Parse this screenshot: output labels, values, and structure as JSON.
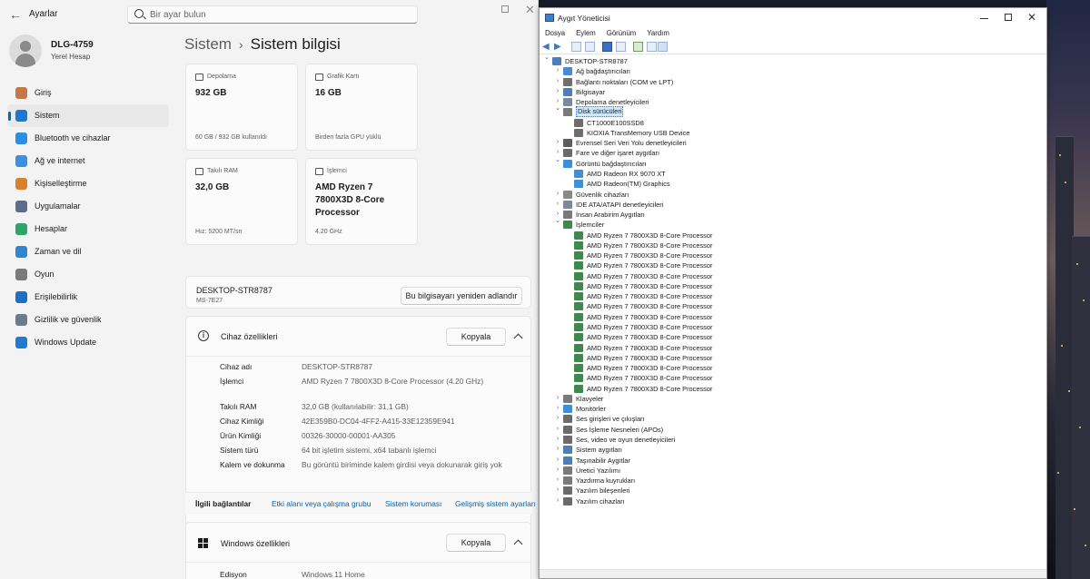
{
  "settings": {
    "app_title": "Ayarlar",
    "search_placeholder": "Bir ayar bulun",
    "user": {
      "name": "DLG-4759",
      "account": "Yerel Hesap"
    },
    "nav": [
      {
        "label": "Giriş",
        "color": "#c4784a",
        "icon": "home-icon"
      },
      {
        "label": "Sistem",
        "color": "#1c78d4",
        "icon": "system-icon",
        "active": true
      },
      {
        "label": "Bluetooth ve cihazlar",
        "color": "#2b8ee0",
        "icon": "bluetooth-icon"
      },
      {
        "label": "Ağ ve internet",
        "color": "#3d8fe0",
        "icon": "wifi-icon"
      },
      {
        "label": "Kişiselleştirme",
        "color": "#d8812c",
        "icon": "brush-icon"
      },
      {
        "label": "Uygulamalar",
        "color": "#5a6e8c",
        "icon": "apps-icon"
      },
      {
        "label": "Hesaplar",
        "color": "#2fa36b",
        "icon": "accounts-icon"
      },
      {
        "label": "Zaman ve dil",
        "color": "#2e86d3",
        "icon": "globe-clock-icon"
      },
      {
        "label": "Oyun",
        "color": "#7a7a7a",
        "icon": "gamepad-icon"
      },
      {
        "label": "Erişilebilirlik",
        "color": "#1e6fc1",
        "icon": "accessibility-icon"
      },
      {
        "label": "Gizlilik ve güvenlik",
        "color": "#6b7b8c",
        "icon": "shield-icon"
      },
      {
        "label": "Windows Update",
        "color": "#1f7bd0",
        "icon": "update-icon"
      }
    ],
    "breadcrumb": {
      "parent": "Sistem",
      "sep": "›",
      "current": "Sistem bilgisi"
    },
    "cards": [
      {
        "title": "Depolama",
        "value": "932 GB",
        "sub": "60 GB / 932 GB kullanıldı"
      },
      {
        "title": "Grafik Kartı",
        "value": "16 GB",
        "sub": "Birden fazla GPU yüklü"
      },
      {
        "title": "Takılı RAM",
        "value": "32,0 GB",
        "sub": "Hız: 5200 MT/sn"
      },
      {
        "title": "İşlemci",
        "value_line1": "AMD Ryzen 7",
        "value_line2": "7800X3D 8-Core",
        "value_line3": "Processor",
        "sub": "4.20 GHz"
      }
    ],
    "device": {
      "name": "DESKTOP-STR8787",
      "model": "MS-7E27",
      "rename_label": "Bu bilgisayarı yeniden adlandır"
    },
    "specs": {
      "title": "Cihaz özellikleri",
      "copy_label": "Kopyala",
      "rows": [
        {
          "k": "Cihaz adı",
          "v": "DESKTOP-STR8787"
        },
        {
          "k": "İşlemci",
          "v": "AMD Ryzen 7 7800X3D 8-Core Processor      (4.20 GHz)"
        },
        {
          "k": "Takılı RAM",
          "v": "32,0 GB (kullanılabilir: 31,1 GB)"
        },
        {
          "k": "Cihaz Kimliği",
          "v": "42E359B0-DC04-4FF2-A415-33E12359E941"
        },
        {
          "k": "Ürün Kimliği",
          "v": "00326-30000-00001-AA305"
        },
        {
          "k": "Sistem türü",
          "v": "64 bit işletim sistemi, x64 tabanlı işlemci"
        },
        {
          "k": "Kalem ve dokunma",
          "v": "Bu görüntü biriminde kalem girdisi veya dokunarak giriş yok"
        }
      ]
    },
    "related": {
      "label": "İlgili bağlantılar",
      "links": [
        "Etki alanı veya çalışma grubu",
        "Sistem koruması",
        "Gelişmiş sistem ayarları"
      ]
    },
    "windows": {
      "title": "Windows özellikleri",
      "copy_label": "Kopyala",
      "edition_key": "Edisyon",
      "edition_value": "Windows 11 Home"
    }
  },
  "device_manager": {
    "title": "Aygıt Yöneticisi",
    "menu": [
      "Dosya",
      "Eylem",
      "Görünüm",
      "Yardım"
    ],
    "tree": [
      {
        "label": "DESKTOP-STR8787",
        "level": 0,
        "exp": "v",
        "icon": "computer-icon",
        "color": "#4c7fb9"
      },
      {
        "label": "Ağ bağdaştırıcıları",
        "level": 1,
        "exp": ">",
        "icon": "network-icon",
        "color": "#4b8ad1"
      },
      {
        "label": "Bağlantı noktaları (COM ve LPT)",
        "level": 1,
        "exp": ">",
        "icon": "port-icon",
        "color": "#6f6f6f"
      },
      {
        "label": "Bilgisayar",
        "level": 1,
        "exp": ">",
        "icon": "computer-icon",
        "color": "#4c7fb9"
      },
      {
        "label": "Depolama denetleyicileri",
        "level": 1,
        "exp": ">",
        "icon": "storage-controller-icon",
        "color": "#7a8aa0"
      },
      {
        "label": "Disk sürücüleri",
        "level": 1,
        "exp": "v",
        "icon": "disk-drive-icon",
        "color": "#7a7a7a",
        "selected": true
      },
      {
        "label": "CT1000E100SSD8",
        "level": 2,
        "icon": "disk-icon",
        "color": "#6d6d6d"
      },
      {
        "label": "KIOXIA TransMemory USB Device",
        "level": 2,
        "icon": "disk-icon",
        "color": "#6d6d6d"
      },
      {
        "label": "Evrensel Seri Veri Yolu denetleyicileri",
        "level": 1,
        "exp": ">",
        "icon": "usb-icon",
        "color": "#5d5d5d"
      },
      {
        "label": "Fare ve diğer işaret aygıtları",
        "level": 1,
        "exp": ">",
        "icon": "mouse-icon",
        "color": "#6b6b6b"
      },
      {
        "label": "Görüntü bağdaştırıcıları",
        "level": 1,
        "exp": "v",
        "icon": "display-adapter-icon",
        "color": "#3f8ed6"
      },
      {
        "label": "AMD Radeon RX 9070 XT",
        "level": 2,
        "icon": "gpu-icon",
        "color": "#3f8ed6"
      },
      {
        "label": "AMD Radeon(TM) Graphics",
        "level": 2,
        "icon": "gpu-icon",
        "color": "#3f8ed6"
      },
      {
        "label": "Güvenlik cihazları",
        "level": 1,
        "exp": ">",
        "icon": "security-device-icon",
        "color": "#8a8a8a"
      },
      {
        "label": "IDE ATA/ATAPI denetleyicileri",
        "level": 1,
        "exp": ">",
        "icon": "ide-icon",
        "color": "#7a8aa0"
      },
      {
        "label": "İnsan Arabirim Aygıtları",
        "level": 1,
        "exp": ">",
        "icon": "hid-icon",
        "color": "#7a7a7a"
      },
      {
        "label": "İşlemciler",
        "level": 1,
        "exp": "v",
        "icon": "cpu-icon",
        "color": "#3f8a4a"
      },
      {
        "label": "AMD Ryzen 7 7800X3D 8-Core Processor",
        "level": 2,
        "icon": "cpu-icon",
        "color": "#3f8a4a"
      },
      {
        "label": "AMD Ryzen 7 7800X3D 8-Core Processor",
        "level": 2,
        "icon": "cpu-icon",
        "color": "#3f8a4a"
      },
      {
        "label": "AMD Ryzen 7 7800X3D 8-Core Processor",
        "level": 2,
        "icon": "cpu-icon",
        "color": "#3f8a4a"
      },
      {
        "label": "AMD Ryzen 7 7800X3D 8-Core Processor",
        "level": 2,
        "icon": "cpu-icon",
        "color": "#3f8a4a"
      },
      {
        "label": "AMD Ryzen 7 7800X3D 8-Core Processor",
        "level": 2,
        "icon": "cpu-icon",
        "color": "#3f8a4a"
      },
      {
        "label": "AMD Ryzen 7 7800X3D 8-Core Processor",
        "level": 2,
        "icon": "cpu-icon",
        "color": "#3f8a4a"
      },
      {
        "label": "AMD Ryzen 7 7800X3D 8-Core Processor",
        "level": 2,
        "icon": "cpu-icon",
        "color": "#3f8a4a"
      },
      {
        "label": "AMD Ryzen 7 7800X3D 8-Core Processor",
        "level": 2,
        "icon": "cpu-icon",
        "color": "#3f8a4a"
      },
      {
        "label": "AMD Ryzen 7 7800X3D 8-Core Processor",
        "level": 2,
        "icon": "cpu-icon",
        "color": "#3f8a4a"
      },
      {
        "label": "AMD Ryzen 7 7800X3D 8-Core Processor",
        "level": 2,
        "icon": "cpu-icon",
        "color": "#3f8a4a"
      },
      {
        "label": "AMD Ryzen 7 7800X3D 8-Core Processor",
        "level": 2,
        "icon": "cpu-icon",
        "color": "#3f8a4a"
      },
      {
        "label": "AMD Ryzen 7 7800X3D 8-Core Processor",
        "level": 2,
        "icon": "cpu-icon",
        "color": "#3f8a4a"
      },
      {
        "label": "AMD Ryzen 7 7800X3D 8-Core Processor",
        "level": 2,
        "icon": "cpu-icon",
        "color": "#3f8a4a"
      },
      {
        "label": "AMD Ryzen 7 7800X3D 8-Core Processor",
        "level": 2,
        "icon": "cpu-icon",
        "color": "#3f8a4a"
      },
      {
        "label": "AMD Ryzen 7 7800X3D 8-Core Processor",
        "level": 2,
        "icon": "cpu-icon",
        "color": "#3f8a4a"
      },
      {
        "label": "AMD Ryzen 7 7800X3D 8-Core Processor",
        "level": 2,
        "icon": "cpu-icon",
        "color": "#3f8a4a"
      },
      {
        "label": "Klavyeler",
        "level": 1,
        "exp": ">",
        "icon": "keyboard-icon",
        "color": "#7a7a7a"
      },
      {
        "label": "Monitörler",
        "level": 1,
        "exp": ">",
        "icon": "monitor-icon",
        "color": "#3f8ed6"
      },
      {
        "label": "Ses girişleri ve çıkışları",
        "level": 1,
        "exp": ">",
        "icon": "audio-io-icon",
        "color": "#6b6b6b"
      },
      {
        "label": "Ses İşleme Nesneleri (APOs)",
        "level": 1,
        "exp": ">",
        "icon": "audio-apo-icon",
        "color": "#6b6b6b"
      },
      {
        "label": "Ses, video ve oyun denetleyicileri",
        "level": 1,
        "exp": ">",
        "icon": "sound-controller-icon",
        "color": "#6b6b6b"
      },
      {
        "label": "Sistem aygıtları",
        "level": 1,
        "exp": ">",
        "icon": "system-device-icon",
        "color": "#4c7fb9"
      },
      {
        "label": "Taşınabilir Aygıtlar",
        "level": 1,
        "exp": ">",
        "icon": "portable-device-icon",
        "color": "#4c7fb9"
      },
      {
        "label": "Üretici Yazılımı",
        "level": 1,
        "exp": ">",
        "icon": "firmware-icon",
        "color": "#7a7a7a"
      },
      {
        "label": "Yazdırma kuyrukları",
        "level": 1,
        "exp": ">",
        "icon": "printer-icon",
        "color": "#7a7a7a"
      },
      {
        "label": "Yazılım bileşenleri",
        "level": 1,
        "exp": ">",
        "icon": "software-component-icon",
        "color": "#6b6b6b"
      },
      {
        "label": "Yazılım cihazları",
        "level": 1,
        "exp": ">",
        "icon": "software-device-icon",
        "color": "#6b6b6b"
      }
    ]
  }
}
